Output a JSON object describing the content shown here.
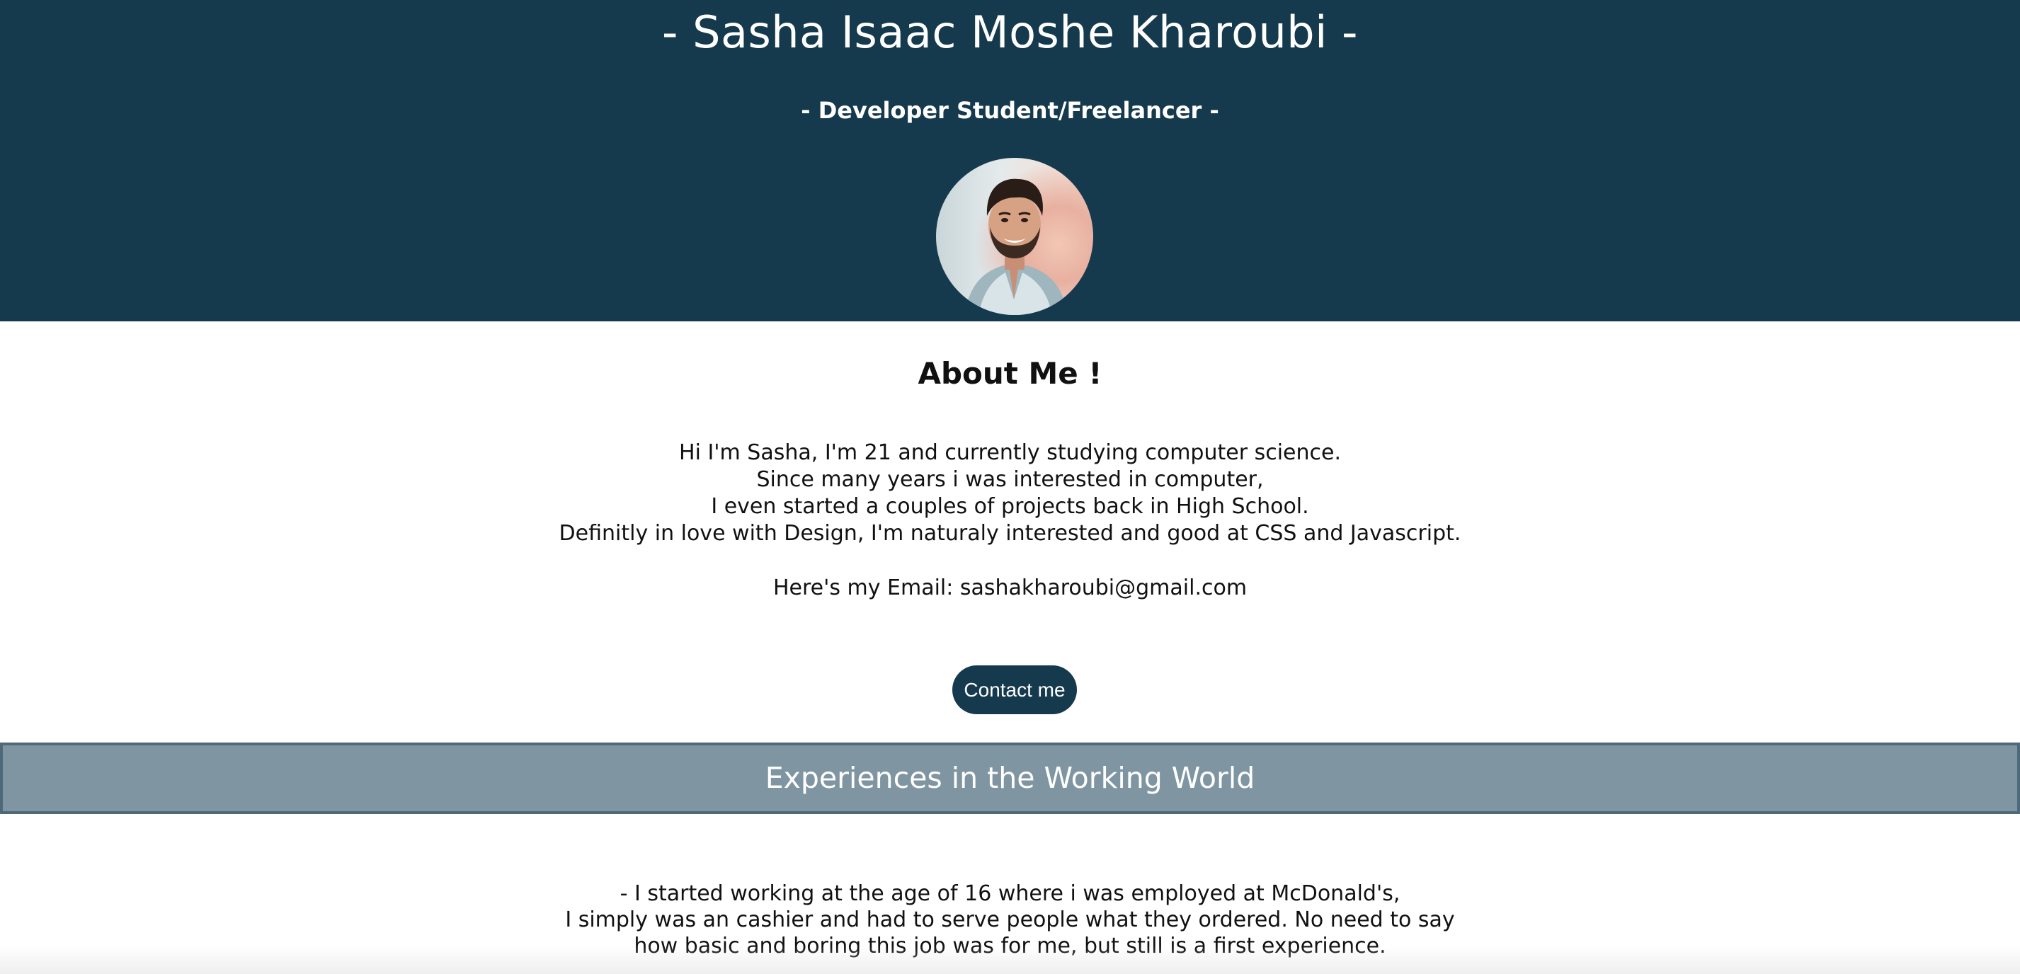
{
  "header": {
    "name": "- Sasha Isaac Moshe Kharoubi -",
    "role": "- Developer Student/Freelancer -",
    "avatar_icon": "profile-photo"
  },
  "about": {
    "title": "About Me !",
    "lines": [
      "Hi I'm Sasha, I'm 21 and currently studying computer science.",
      "Since many years i was interested in computer,",
      "I even started a couples of projects back in High School.",
      "Definitly in love with Design, I'm naturaly interested and good at CSS and Javascript."
    ],
    "email_line": "Here's my Email: sashakharoubi@gmail.com",
    "contact_button": "Contact me"
  },
  "experiences": {
    "banner": "Experiences in the Working World",
    "lines": [
      "- I started working at the age of 16 where i was employed at McDonald's,",
      "I simply was an cashier and had to serve people what they ordered. No need to say",
      "how basic and boring this job was for me, but still is a first experience."
    ]
  },
  "colors": {
    "header_bg": "#163a4d",
    "banner_bg": "#7f96a2",
    "banner_border": "#4e6a7a",
    "button_bg": "#163a4d"
  }
}
